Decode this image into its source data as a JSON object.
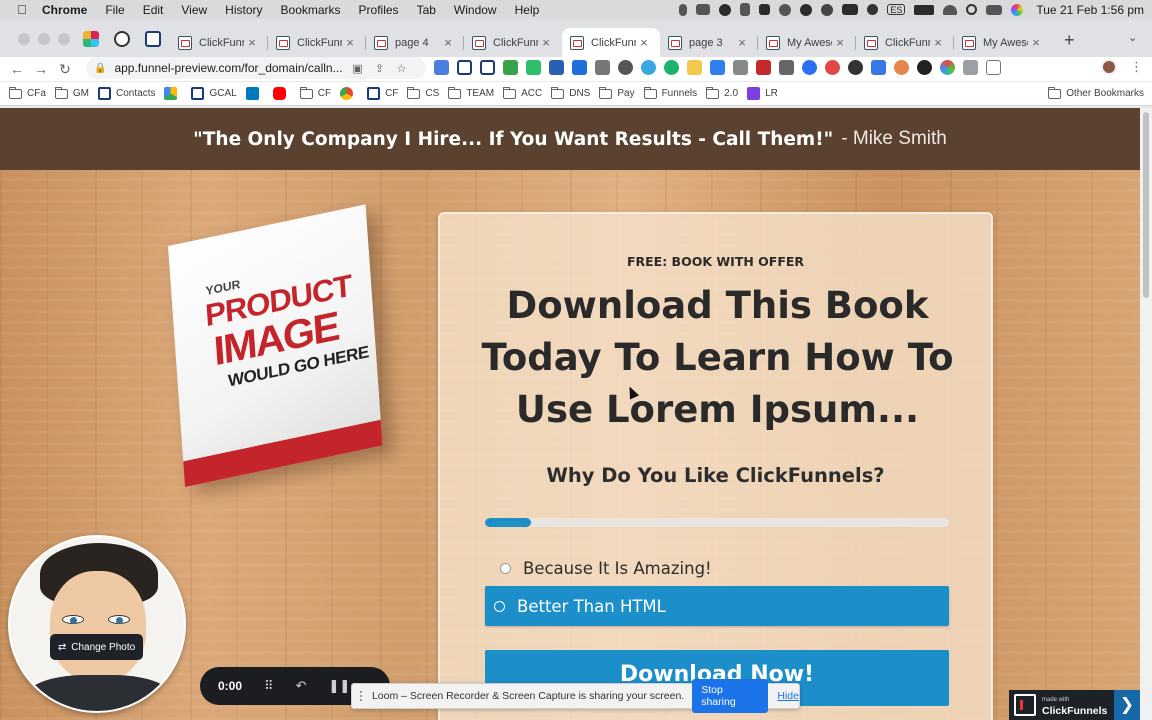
{
  "menubar": {
    "app": "Chrome",
    "items": [
      "File",
      "Edit",
      "View",
      "History",
      "Bookmarks",
      "Profiles",
      "Tab",
      "Window",
      "Help"
    ],
    "status_icons": [
      "mic-icon",
      "screen-icon",
      "record-icon",
      "clipboard-icon",
      "person-icon",
      "brush-icon",
      "check-icon",
      "g-icon",
      "battery-ext-icon",
      "moon-icon",
      "es-input",
      "battery-icon",
      "wifi-icon",
      "search-icon",
      "control-center-icon",
      "siri-icon"
    ],
    "input_source": "ES",
    "clock": "Tue 21 Feb  1:56 pm"
  },
  "tabs": [
    {
      "title": "ClickFunn",
      "active": false
    },
    {
      "title": "ClickFunn",
      "active": false
    },
    {
      "title": "page 4",
      "active": false
    },
    {
      "title": "ClickFunn",
      "active": false
    },
    {
      "title": "ClickFunn",
      "active": true
    },
    {
      "title": "page 3",
      "active": false
    },
    {
      "title": "My Aweso",
      "active": false
    },
    {
      "title": "ClickFunn",
      "active": false
    },
    {
      "title": "My Aweso",
      "active": false
    }
  ],
  "toolbar": {
    "url": "app.funnel-preview.com/for_domain/calln..."
  },
  "bookmarks": [
    {
      "label": "CFa",
      "kind": "folder"
    },
    {
      "label": "GM",
      "kind": "folder"
    },
    {
      "label": "Contacts",
      "kind": "site"
    },
    {
      "label": "",
      "kind": "drive"
    },
    {
      "label": "GCAL",
      "kind": "site"
    },
    {
      "label": "",
      "kind": "trello"
    },
    {
      "label": "",
      "kind": "youtube"
    },
    {
      "label": "CF",
      "kind": "folder"
    },
    {
      "label": "",
      "kind": "chrome"
    },
    {
      "label": "CF",
      "kind": "site"
    },
    {
      "label": "CS",
      "kind": "folder"
    },
    {
      "label": "TEAM",
      "kind": "folder"
    },
    {
      "label": "ACC",
      "kind": "folder"
    },
    {
      "label": "DNS",
      "kind": "folder"
    },
    {
      "label": "Pay",
      "kind": "folder"
    },
    {
      "label": "Funnels",
      "kind": "folder"
    },
    {
      "label": "2.0",
      "kind": "folder"
    },
    {
      "label": "LR",
      "kind": "site"
    }
  ],
  "other_bookmarks": "Other Bookmarks",
  "page": {
    "quote": "\"The Only Company I Hire... If You Want Results - Call Them!\"",
    "quote_author": "- Mike Smith",
    "book": {
      "line1": "YOUR",
      "line2": "PRODUCT",
      "line3": "IMAGE",
      "line4": "WOULD GO HERE"
    },
    "eyebrow": "FREE: BOOK WITH OFFER",
    "headline": "Download This Book Today To Learn How To Use Lorem Ipsum...",
    "question": "Why Do You Like ClickFunnels?",
    "progress_fraction": 0.1,
    "options": [
      {
        "label": "Because It Is Amazing!",
        "selected": false
      },
      {
        "label": "Better Than HTML",
        "selected": true
      }
    ],
    "cta": "Download Now!"
  },
  "loom": {
    "change_photo": "Change Photo",
    "timer": "0:00",
    "share_message": "Loom – Screen Recorder & Screen Capture is sharing your screen.",
    "stop_sharing": "Stop sharing",
    "hide": "Hide"
  },
  "badge": {
    "small": "made with",
    "big": "ClickFunnels"
  },
  "colors": {
    "accent": "#1c8fcb",
    "hero_bar": "#5b4230",
    "book_red": "#c4252b"
  }
}
